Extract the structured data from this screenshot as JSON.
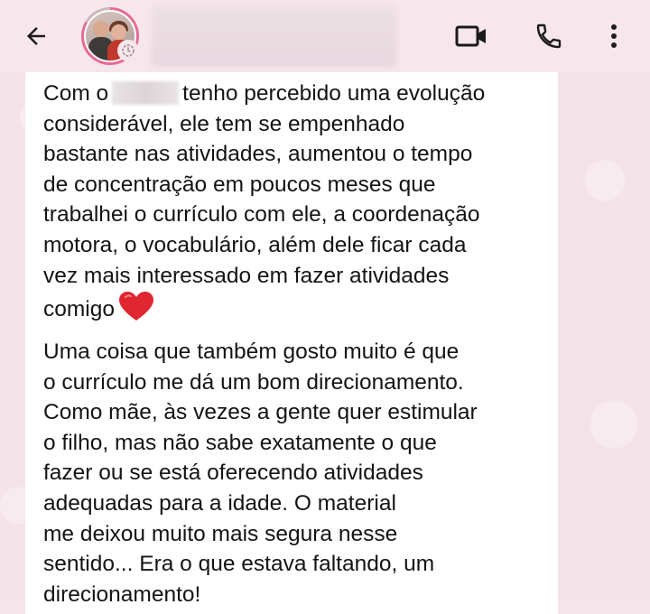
{
  "header": {
    "back_icon": "arrow-left-icon",
    "avatar_icon": "avatar",
    "status_icon": "status-ring-icon",
    "video_icon": "video-camera-icon",
    "call_icon": "phone-icon",
    "menu_icon": "more-vertical-icon"
  },
  "message": {
    "para1_start": "Com o",
    "para1_rest": "tenho percebido uma evolução\nconsiderável, ele tem se empenhado\nbastante nas atividades, aumentou o tempo\nde concentração em poucos meses que\ntrabalhei o currículo com ele, a coordenação\nmotora, o vocabulário, além dele ficar cada\nvez mais interessado em fazer atividades\ncomigo",
    "heart_emoji": "heart-emoji-icon",
    "para2": "Uma coisa que também gosto muito é que\no currículo me dá um bom direcionamento.\nComo mãe, às vezes a gente quer estimular\no filho, mas não sabe exatamente o que\nfazer ou se está oferecendo atividades\nadequadas para a idade. O material\nme deixou muito mais segura nesse\nsentido... Era o que estava faltando, um\ndirecionamento!"
  },
  "colors": {
    "wallpaper": "#f4e2e9",
    "bubble": "#ffffff",
    "text": "#141414",
    "heart": "#e02630",
    "status_ring": "#e86a93"
  }
}
